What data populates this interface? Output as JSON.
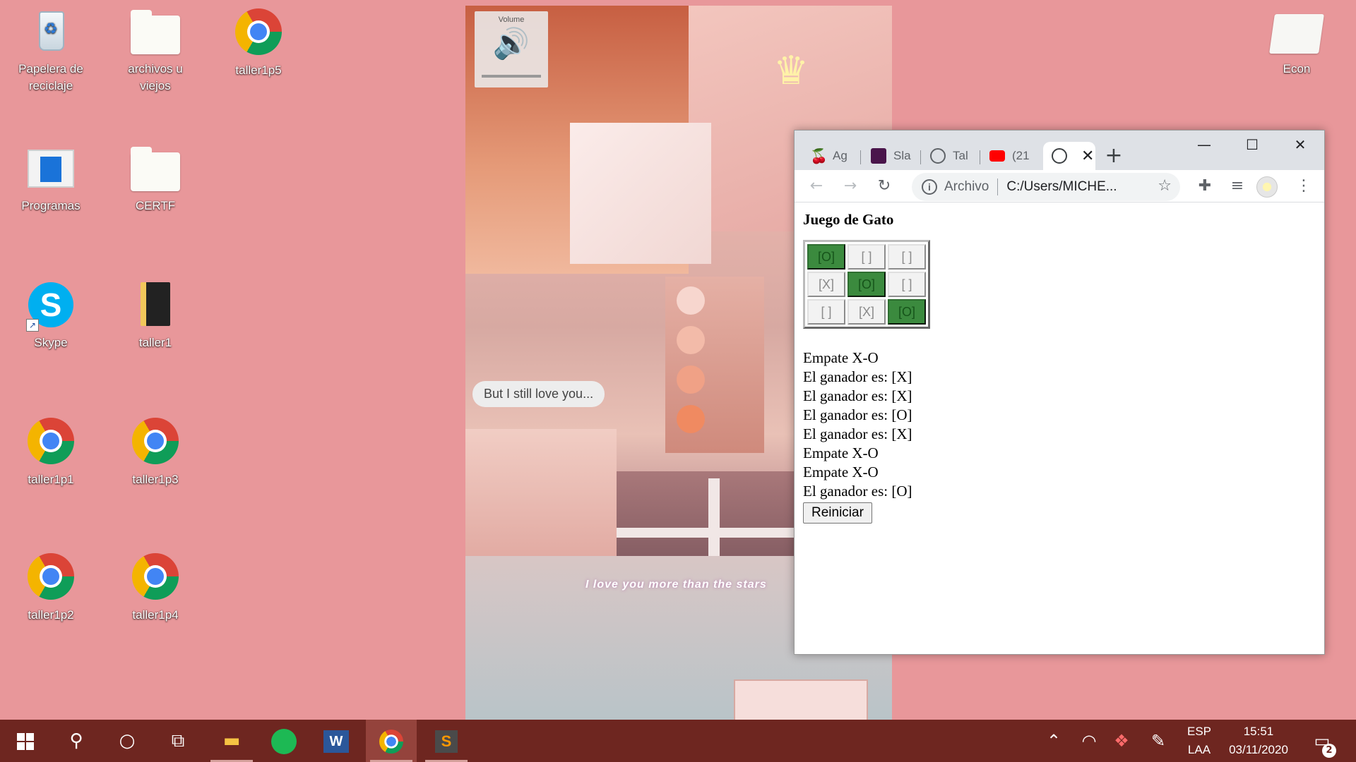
{
  "desktop": {
    "icons": [
      {
        "label": "Papelera de reciclaje",
        "icon": "recycle-bin-icon"
      },
      {
        "label": "archivos u viejos",
        "icon": "folder-icon"
      },
      {
        "label": "taller1p5",
        "icon": "chrome-icon"
      },
      {
        "label": "Programas",
        "icon": "programs-icon"
      },
      {
        "label": "CERTF",
        "icon": "folder-icon"
      },
      {
        "label": "Skype",
        "icon": "skype-icon"
      },
      {
        "label": "taller1",
        "icon": "folder-icon"
      },
      {
        "label": "taller1p1",
        "icon": "chrome-icon"
      },
      {
        "label": "taller1p3",
        "icon": "chrome-icon"
      },
      {
        "label": "taller1p2",
        "icon": "chrome-icon"
      },
      {
        "label": "taller1p4",
        "icon": "chrome-icon"
      },
      {
        "label": "Econ",
        "icon": "folder-open-icon"
      }
    ],
    "background_color": "#e8979a"
  },
  "wallpaper": {
    "volume_label": "Volume",
    "bubble_text": "But I still love you...",
    "caption_text": "I love you more than the stars"
  },
  "chrome": {
    "tabs": [
      {
        "label": "Ag",
        "favicon": "cherry-icon"
      },
      {
        "label": "Sla",
        "favicon": "slack-icon"
      },
      {
        "label": "Tal",
        "favicon": "globe-icon"
      },
      {
        "label": "(21",
        "favicon": "youtube-icon"
      },
      {
        "label": "",
        "favicon": "globe-icon",
        "active": true
      }
    ],
    "new_tab_symbol": "+",
    "minimize_symbol": "—",
    "maximize_symbol": "☐",
    "close_symbol": "✕",
    "address": {
      "scheme_label": "Archivo",
      "url": "C:/Users/MICHE..."
    }
  },
  "page": {
    "title": "Juego de Gato",
    "board": [
      [
        {
          "text": "[O]",
          "win": true
        },
        {
          "text": "[ ]",
          "win": false
        },
        {
          "text": "[ ]",
          "win": false
        }
      ],
      [
        {
          "text": "[X]",
          "win": false
        },
        {
          "text": "[O]",
          "win": true
        },
        {
          "text": "[ ]",
          "win": false
        }
      ],
      [
        {
          "text": "[ ]",
          "win": false
        },
        {
          "text": "[X]",
          "win": false
        },
        {
          "text": "[O]",
          "win": true
        }
      ]
    ],
    "results": [
      "Empate X-O",
      "El ganador es: [X]",
      "El ganador es: [X]",
      "El ganador es: [O]",
      "El ganador es: [X]",
      "Empate X-O",
      "Empate X-O",
      "El ganador es: [O]"
    ],
    "restart_label": "Reiniciar",
    "win_color": "#3b8a3e"
  },
  "taskbar": {
    "apps": [
      "start-icon",
      "search-icon",
      "cortana-icon",
      "task-view-icon",
      "file-explorer-icon",
      "spotify-icon",
      "word-icon",
      "chrome-icon",
      "sublime-text-icon"
    ],
    "language_top": "ESP",
    "language_bottom": "LAA",
    "time": "15:51",
    "date": "03/11/2020",
    "notification_count": "2",
    "color": "#6e2620"
  }
}
